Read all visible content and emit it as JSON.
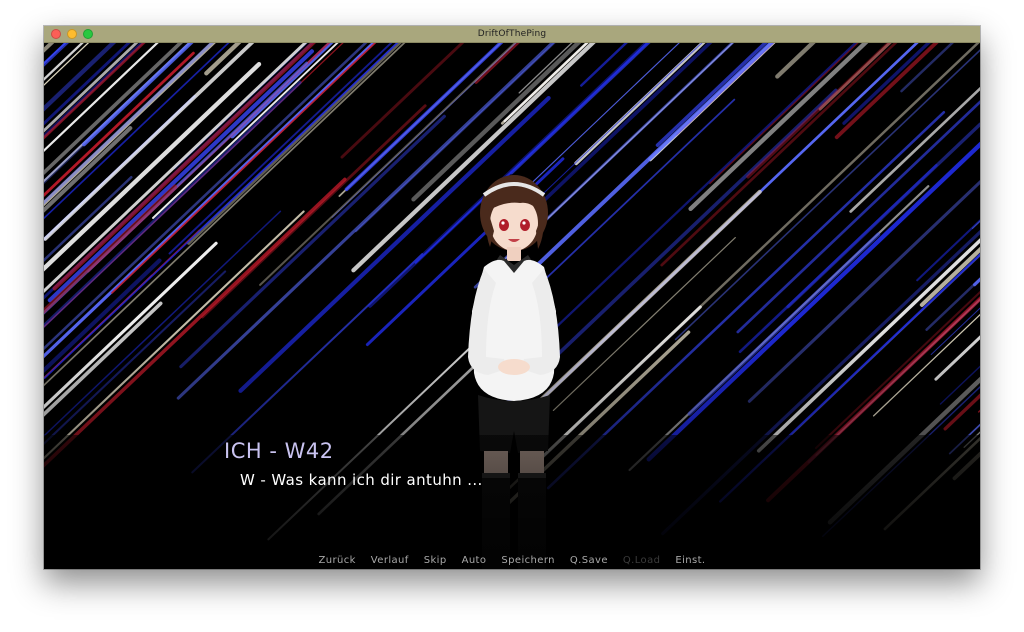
{
  "window": {
    "title": "DriftOfThePing",
    "titlebar_color": "#a9a77d",
    "buttons": [
      {
        "name": "close",
        "color": "#fc5f57"
      },
      {
        "name": "minimize",
        "color": "#fdbc2e"
      },
      {
        "name": "zoom",
        "color": "#28c840"
      }
    ]
  },
  "scene": {
    "background": "diagonal-light-streaks",
    "streak_colors": [
      "#1f2be0",
      "#3848ff",
      "#e8e0c8",
      "#c01a2a",
      "#ffffff",
      "#5a6cff"
    ],
    "character": "girl-in-white-blouse"
  },
  "dialogue": {
    "speaker": "ICH - W42",
    "speaker_color": "#c9c3f0",
    "text": "W - Was kann ich dir antuhn ..."
  },
  "quick_menu": {
    "items": [
      {
        "label": "Zurück",
        "enabled": true
      },
      {
        "label": "Verlauf",
        "enabled": true
      },
      {
        "label": "Skip",
        "enabled": true
      },
      {
        "label": "Auto",
        "enabled": true
      },
      {
        "label": "Speichern",
        "enabled": true
      },
      {
        "label": "Q.Save",
        "enabled": true
      },
      {
        "label": "Q.Load",
        "enabled": false
      },
      {
        "label": "Einst.",
        "enabled": true
      }
    ]
  }
}
